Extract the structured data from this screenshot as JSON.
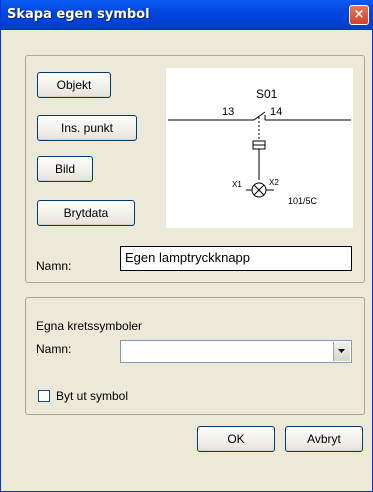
{
  "window": {
    "title": "Skapa egen symbol",
    "close_glyph": "×"
  },
  "symbol_panel": {
    "buttons": {
      "objekt": "Objekt",
      "ins_punkt": "Ins. punkt",
      "bild": "Bild",
      "brytdata": "Brytdata"
    },
    "preview": {
      "component_label": "S01",
      "terminal_left": "13",
      "terminal_right": "14",
      "lamp_terminal_1": "X1",
      "lamp_terminal_2": "X2",
      "reference": "101/5C"
    },
    "name_label": "Namn:",
    "name_value": "Egen lamptryckknapp"
  },
  "circuit_panel": {
    "heading": "Egna kretssymboler",
    "name_label": "Namn:",
    "name_selected": "",
    "replace_checkbox_label": "Byt ut symbol",
    "replace_checked": false
  },
  "footer": {
    "ok_label": "OK",
    "cancel_label": "Avbryt"
  },
  "icons": [
    "close-icon",
    "chevron-down-icon"
  ]
}
